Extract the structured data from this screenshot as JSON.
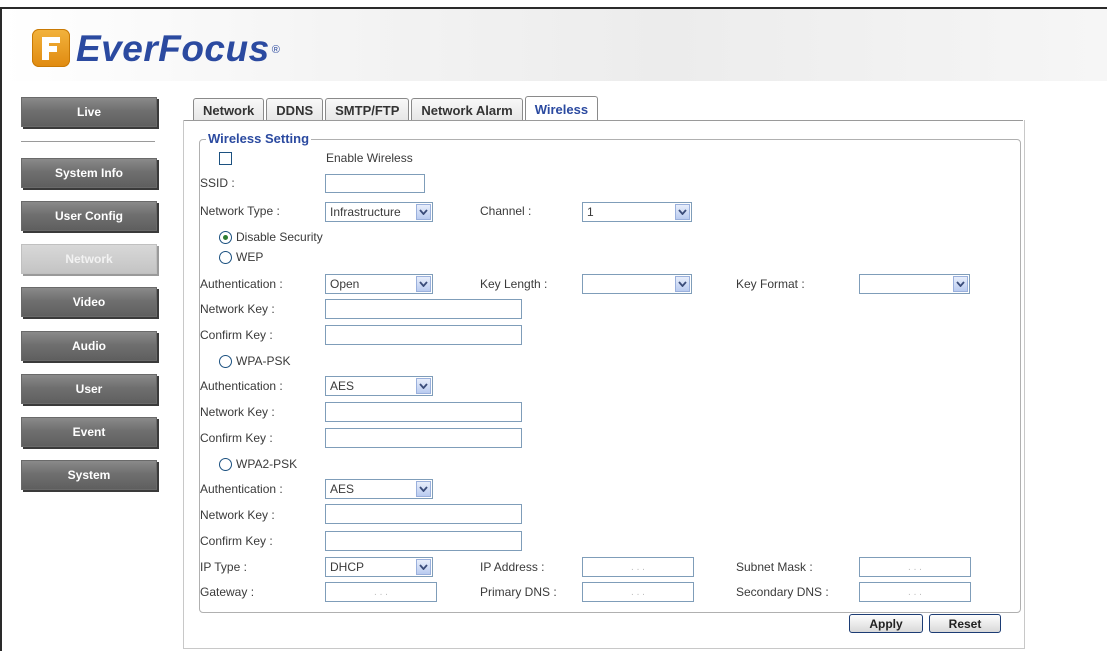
{
  "brand": {
    "name": "EverFocus",
    "registered": "®"
  },
  "nav": [
    {
      "label": "Live"
    },
    {
      "label": "System Info"
    },
    {
      "label": "User Config"
    },
    {
      "label": "Network",
      "active": true
    },
    {
      "label": "Video"
    },
    {
      "label": "Audio"
    },
    {
      "label": "User"
    },
    {
      "label": "Event"
    },
    {
      "label": "System"
    }
  ],
  "tabs": [
    {
      "label": "Network"
    },
    {
      "label": "DDNS"
    },
    {
      "label": "SMTP/FTP"
    },
    {
      "label": "Network Alarm"
    },
    {
      "label": "Wireless",
      "active": true
    }
  ],
  "form": {
    "legend": "Wireless Setting",
    "enable_label": "Enable Wireless",
    "ssid_label": "SSID :",
    "ssid_value": "",
    "network_type_label": "Network Type :",
    "network_type_value": "Infrastructure",
    "channel_label": "Channel :",
    "channel_value": "1",
    "disable_security": "Disable Security",
    "wep": {
      "label": "WEP",
      "auth_label": "Authentication :",
      "auth_value": "Open",
      "key_length_label": "Key Length :",
      "key_length_value": "",
      "key_format_label": "Key Format :",
      "key_format_value": "",
      "network_key_label": "Network Key :",
      "confirm_key_label": "Confirm Key :"
    },
    "wpa": {
      "label": "WPA-PSK",
      "auth_label": "Authentication :",
      "auth_value": "AES",
      "network_key_label": "Network Key :",
      "confirm_key_label": "Confirm Key :"
    },
    "wpa2": {
      "label": "WPA2-PSK",
      "auth_label": "Authentication :",
      "auth_value": "AES",
      "network_key_label": "Network Key :",
      "confirm_key_label": "Confirm Key :"
    },
    "ip_type_label": "IP Type :",
    "ip_type_value": "DHCP",
    "ip_address_label": "IP Address :",
    "subnet_mask_label": "Subnet Mask :",
    "gateway_label": "Gateway :",
    "primary_dns_label": "Primary DNS :",
    "secondary_dns_label": "Secondary DNS :",
    "ip_dots": ".   .   ."
  },
  "buttons": {
    "apply": "Apply",
    "reset": "Reset"
  },
  "colors": {
    "brand_blue": "#2b4aa0",
    "logo_orange": "#e8951f",
    "nav_gray": "#6f6f6f"
  }
}
